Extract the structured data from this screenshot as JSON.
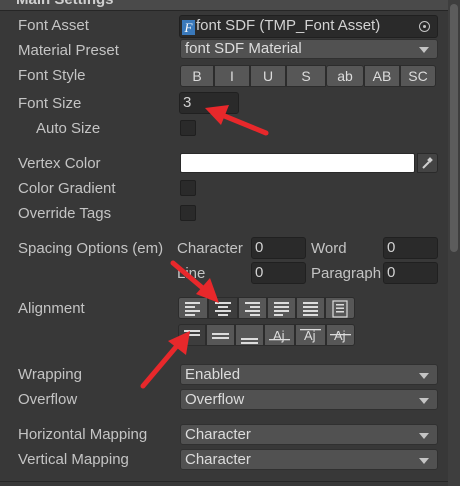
{
  "section_title": "Main Settings",
  "font_asset": {
    "label": "Font Asset",
    "value": "font SDF (TMP_Font Asset)"
  },
  "material_preset": {
    "label": "Material Preset",
    "value": "font SDF Material"
  },
  "font_style": {
    "label": "Font Style",
    "buttons": [
      "B",
      "I",
      "U",
      "S",
      "ab",
      "AB",
      "SC"
    ]
  },
  "font_size": {
    "label": "Font Size",
    "value": "3"
  },
  "auto_size": {
    "label": "Auto Size"
  },
  "vertex_color": {
    "label": "Vertex Color",
    "color": "#ffffff"
  },
  "color_gradient": {
    "label": "Color Gradient"
  },
  "override_tags": {
    "label": "Override Tags"
  },
  "spacing": {
    "label": "Spacing Options (em)",
    "character_label": "Character",
    "character_value": "0",
    "word_label": "Word",
    "word_value": "0",
    "line_label": "Line",
    "line_value": "0",
    "paragraph_label": "Paragraph",
    "paragraph_value": "0"
  },
  "alignment": {
    "label": "Alignment",
    "horizontal": [
      "align-left-icon",
      "align-center-icon",
      "align-right-icon",
      "align-justified-icon",
      "align-flush-icon",
      "align-geometry-center-icon"
    ],
    "horizontal_selected": 1,
    "vertical": [
      "align-top-icon",
      "align-middle-icon",
      "align-bottom-icon",
      "align-baseline-icon",
      "align-midline-icon",
      "align-capline-icon"
    ],
    "vertical_selected": 0
  },
  "wrapping": {
    "label": "Wrapping",
    "value": "Enabled"
  },
  "overflow": {
    "label": "Overflow",
    "value": "Overflow"
  },
  "horizontal_mapping": {
    "label": "Horizontal Mapping",
    "value": "Character"
  },
  "vertical_mapping": {
    "label": "Vertical Mapping",
    "value": "Character"
  },
  "colors": {
    "annotation_arrow": "#e8282b",
    "accent": "#3a79bb"
  }
}
